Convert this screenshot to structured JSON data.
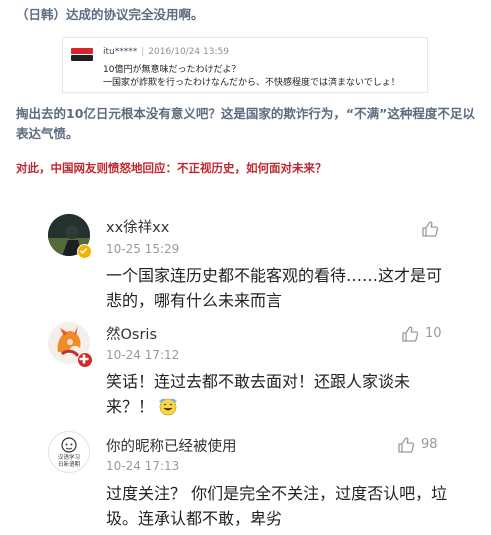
{
  "article": {
    "line1": "（日韩）达成的协议完全没用啊。",
    "paragraph": "掏出去的10亿日元根本没有意义吧？这是国家的欺诈行为，“不满”这种程度不足以表达气愤。",
    "red_line": "对此，中国网友则愤怒地回应：不正视历史，如何面对未来？"
  },
  "quoted_post": {
    "user": "itu*****",
    "separator": "|",
    "date": "2016/10/24 13:59",
    "line1": "10億円が無意味だったわけだよ？",
    "line2": "一国家が詐欺を行ったわけなんだから、不快感程度では済まないでしょ！"
  },
  "comments": [
    {
      "name": "xx徐祥xx",
      "time": "10-25 15:29",
      "likes": "",
      "text": "一个国家连历史都不能客观的看待……这才是可悲的，哪有什么未来而言"
    },
    {
      "name": "然Osris",
      "time": "10-24 17:12",
      "likes": "10",
      "text": "笑话！连过去都不敢去面对！还跟人家谈未来？！"
    },
    {
      "name": "你的昵称已经被使用",
      "time": "10-24 17:13",
      "likes": "98",
      "text": "过度关注？ 你们是完全不关注，过度否认吧，垃圾。连承认都不敢，卑劣",
      "avatar_text": "汉语学习\n日新语期"
    }
  ],
  "colors": {
    "heading": "#5d6c80",
    "red": "#c0282f",
    "badge": "#f5b300"
  }
}
